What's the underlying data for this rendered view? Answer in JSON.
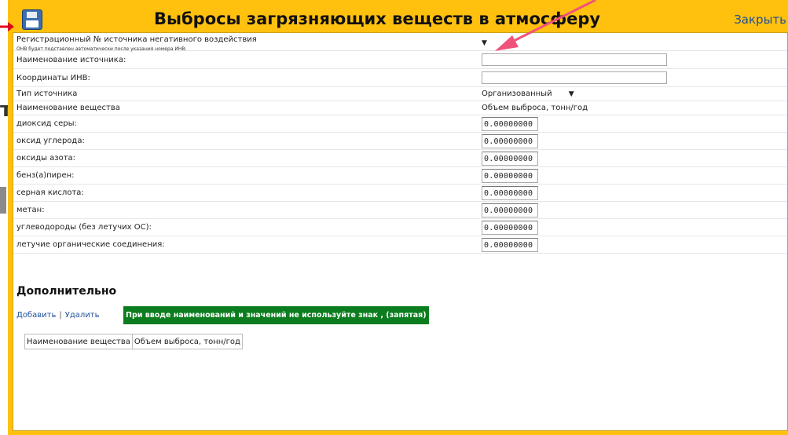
{
  "background": {
    "letter": "т"
  },
  "dialog": {
    "title": "Выбросы загрязняющих веществ в атмосферу",
    "close_label": "Закрыть",
    "save_icon": "floppy-disk-icon"
  },
  "form": {
    "registration_label": "Регистрационный № источника негативного воздействия",
    "registration_note": "ОНВ будет подставлен автоматически после указания номера ИНВ:",
    "registration_value": "",
    "source_name_label": "Наименование источника:",
    "source_name_value": "",
    "coords_label": "Координаты ИНВ:",
    "coords_value": "",
    "source_type_label": "Тип источника",
    "source_type_value": "Организованный",
    "substance_header": "Наименование вещества",
    "volume_header": "Объем выброса, тонн/год",
    "substances": [
      {
        "name": "диоксид серы:",
        "value": "0.00000000"
      },
      {
        "name": "оксид углерода:",
        "value": "0.00000000"
      },
      {
        "name": "оксиды азота:",
        "value": "0.00000000"
      },
      {
        "name": "бенз(а)пирен:",
        "value": "0.00000000"
      },
      {
        "name": "серная кислота:",
        "value": "0.00000000"
      },
      {
        "name": "метан:",
        "value": "0.00000000"
      },
      {
        "name": "углеводороды (без летучих ОС):",
        "value": "0.00000000"
      },
      {
        "name": "летучие органические соединения:",
        "value": "0.00000000"
      }
    ]
  },
  "additional": {
    "heading": "Дополнительно",
    "add_label": "Добавить",
    "separator": "|",
    "delete_label": "Удалить",
    "notice": "При вводе наименований и значений не используйте знак , (запятая)",
    "table_headers": [
      "Наименование вещества",
      "Объем выброса, тонн/год"
    ]
  },
  "colors": {
    "frame": "#ffc10e",
    "notice_bg": "#0b7d1f",
    "link": "#1f4e9c",
    "annotation_arrow": "#f0537a",
    "left_marker": "#e0001a"
  }
}
